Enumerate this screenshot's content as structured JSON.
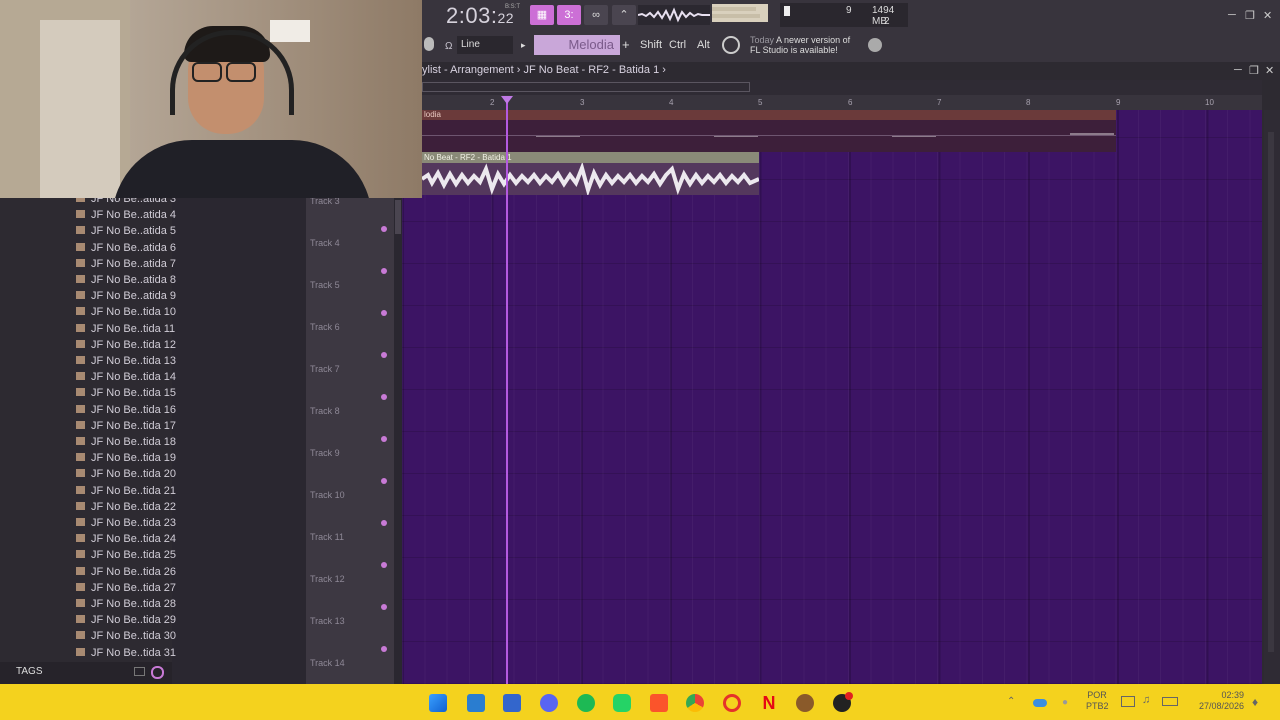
{
  "toolbar": {
    "time_main": "2:03",
    "time_sub": "22",
    "time_unit": "B:S:T",
    "pattern_name": "Melodia",
    "snap_mode": "Line",
    "keys": [
      "Shift",
      "Ctrl",
      "Alt"
    ],
    "cpu_value": "9",
    "memory": "1494 MB",
    "polyphony": "2",
    "news_day": "Today",
    "news_text": "A newer version of FL Studio is available!"
  },
  "playlist": {
    "breadcrumb": "ylist - Arrangement › JF No Beat - RF2 - Batida 1 ›",
    "ruler": [
      "2",
      "3",
      "4",
      "5",
      "6",
      "7",
      "8",
      "9",
      "10"
    ],
    "clips": {
      "melodia": "lodia",
      "audio": "No Beat - RF2 - Batida 1"
    },
    "tracks": [
      "Track 3",
      "Track 4",
      "Track 5",
      "Track 6",
      "Track 7",
      "Track 8",
      "Track 9",
      "Track 10",
      "Track 11",
      "Track 12",
      "Track 13",
      "Track 14"
    ]
  },
  "browser": {
    "items": [
      "JF No Be..atida 3",
      "JF No Be..atida 4",
      "JF No Be..atida 5",
      "JF No Be..atida 6",
      "JF No Be..atida 7",
      "JF No Be..atida 8",
      "JF No Be..atida 9",
      "JF No Be..tida 10",
      "JF No Be..tida 11",
      "JF No Be..tida 12",
      "JF No Be..tida 13",
      "JF No Be..tida 14",
      "JF No Be..tida 15",
      "JF No Be..tida 16",
      "JF No Be..tida 17",
      "JF No Be..tida 18",
      "JF No Be..tida 19",
      "JF No Be..tida 20",
      "JF No Be..tida 21",
      "JF No Be..tida 22",
      "JF No Be..tida 23",
      "JF No Be..tida 24",
      "JF No Be..tida 25",
      "JF No Be..tida 26",
      "JF No Be..tida 27",
      "JF No Be..tida 28",
      "JF No Be..tida 29",
      "JF No Be..tida 30",
      "JF No Be..tida 31"
    ],
    "tags_label": "TAGS"
  },
  "taskbar": {
    "icons": [
      "windows-start",
      "vscode",
      "app",
      "discord",
      "spotify",
      "whatsapp",
      "brave",
      "chrome",
      "opera",
      "netflix",
      "fl-studio",
      "obs"
    ],
    "lang_top": "POR",
    "lang_bottom": "PTB2",
    "time": "02:39",
    "date": "27/08/2026"
  },
  "colors": {
    "accent": "#c87ad6",
    "grid_bg": "#3c1464",
    "taskbar": "#f4d21e"
  }
}
